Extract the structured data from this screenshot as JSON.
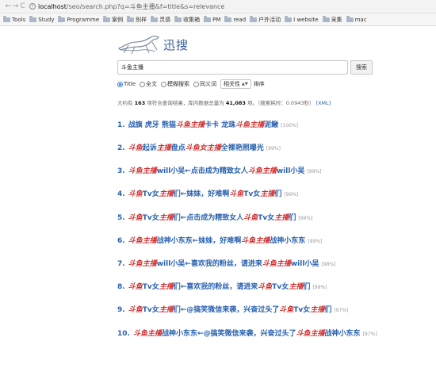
{
  "address_bar": {
    "back": "←",
    "forward": "→",
    "reload": "C",
    "url_host": "localhost",
    "url_path": "/seo/search.php?q=斗鱼主播&f=title&s=relevance"
  },
  "bookmarks": [
    "Tools",
    "Study",
    "Programme",
    "案例",
    "别样",
    "灵感",
    "收集箱",
    "PM",
    "read",
    "户外活动",
    "I website",
    "采集",
    "mac"
  ],
  "logo": {
    "text": "迅搜"
  },
  "search": {
    "value": "斗鱼主播",
    "button": "搜索"
  },
  "options": {
    "fields": [
      {
        "label": "Title",
        "checked": true,
        "type": "radio"
      },
      {
        "label": "全文",
        "checked": false,
        "type": "radio"
      },
      {
        "label": "模糊搜索",
        "checked": false,
        "type": "check"
      },
      {
        "label": "同义词",
        "checked": false,
        "type": "check"
      }
    ],
    "sort_select": "相关性",
    "sort_label": "排序"
  },
  "stats": {
    "prefix": "大约有",
    "count": "163",
    "mid": "项符合查询结果，库内数据总量为",
    "total": "41,083",
    "suffix": "项。（搜索耗时：0.0943秒）",
    "xml": "[XML]"
  },
  "results": [
    {
      "num": "1.",
      "parts": [
        [
          "战旗 虎牙 熊猫 ",
          false
        ],
        [
          "斗鱼主播",
          true
        ],
        [
          "卡卡 龙珠 ",
          false
        ],
        [
          "斗鱼主播",
          true
        ],
        [
          "泥鳅",
          false
        ]
      ],
      "pct": "[100%]"
    },
    {
      "num": "2.",
      "parts": [
        [
          "斗鱼",
          true
        ],
        [
          "起诉",
          false
        ],
        [
          "主播",
          true
        ],
        [
          " 盘点",
          false
        ],
        [
          "斗鱼女主播",
          true
        ],
        [
          "全裸艳照曝光",
          false
        ]
      ],
      "pct": "[99%]"
    },
    {
      "num": "3.",
      "parts": [
        [
          "斗鱼主播",
          true
        ],
        [
          "will小吴←点击成为精致女人",
          false
        ],
        [
          "斗鱼主播",
          true
        ],
        [
          "will小吴",
          false
        ]
      ],
      "pct": "[99%]"
    },
    {
      "num": "4.",
      "parts": [
        [
          "斗鱼",
          true
        ],
        [
          "Tv女",
          false
        ],
        [
          "主播",
          true
        ],
        [
          "们←妹妹，好难啊",
          false
        ],
        [
          "斗鱼",
          true
        ],
        [
          "Tv女",
          false
        ],
        [
          "主播",
          true
        ],
        [
          "们",
          false
        ]
      ],
      "pct": "[99%]"
    },
    {
      "num": "5.",
      "parts": [
        [
          "斗鱼",
          true
        ],
        [
          "Tv女",
          false
        ],
        [
          "主播",
          true
        ],
        [
          "们←点击成为精致女人",
          false
        ],
        [
          "斗鱼",
          true
        ],
        [
          "Tv女",
          false
        ],
        [
          "主播",
          true
        ],
        [
          "们",
          false
        ]
      ],
      "pct": "[99%]"
    },
    {
      "num": "6.",
      "parts": [
        [
          "斗鱼主播",
          true
        ],
        [
          "战神小东东←妹妹，好难啊",
          false
        ],
        [
          "斗鱼主播",
          true
        ],
        [
          "战神小东东",
          false
        ]
      ],
      "pct": "[99%]"
    },
    {
      "num": "7.",
      "parts": [
        [
          "斗鱼主播",
          true
        ],
        [
          "will小吴←喜欢我的粉丝，请进来",
          false
        ],
        [
          "斗鱼主播",
          true
        ],
        [
          "will小吴",
          false
        ]
      ],
      "pct": "[98%]"
    },
    {
      "num": "8.",
      "parts": [
        [
          "斗鱼",
          true
        ],
        [
          "Tv女",
          false
        ],
        [
          "主播",
          true
        ],
        [
          "们←喜欢我的粉丝，请进来",
          false
        ],
        [
          "斗鱼",
          true
        ],
        [
          "Tv女",
          false
        ],
        [
          "主播",
          true
        ],
        [
          "们",
          false
        ]
      ],
      "pct": "[98%]"
    },
    {
      "num": "9.",
      "parts": [
        [
          "斗鱼",
          true
        ],
        [
          "Tv女",
          false
        ],
        [
          "主播",
          true
        ],
        [
          "们←@搞笑微信来袭，兴奋过头了",
          false
        ],
        [
          "斗鱼",
          true
        ],
        [
          "Tv女",
          false
        ],
        [
          "主播",
          true
        ],
        [
          "们",
          false
        ]
      ],
      "pct": "[97%]"
    },
    {
      "num": "10.",
      "parts": [
        [
          "斗鱼主播",
          true
        ],
        [
          "战神小东东←@搞笑微信来袭，兴奋过头了",
          false
        ],
        [
          "斗鱼主播",
          true
        ],
        [
          "战神小东东",
          false
        ]
      ],
      "pct": "[97%]"
    }
  ]
}
